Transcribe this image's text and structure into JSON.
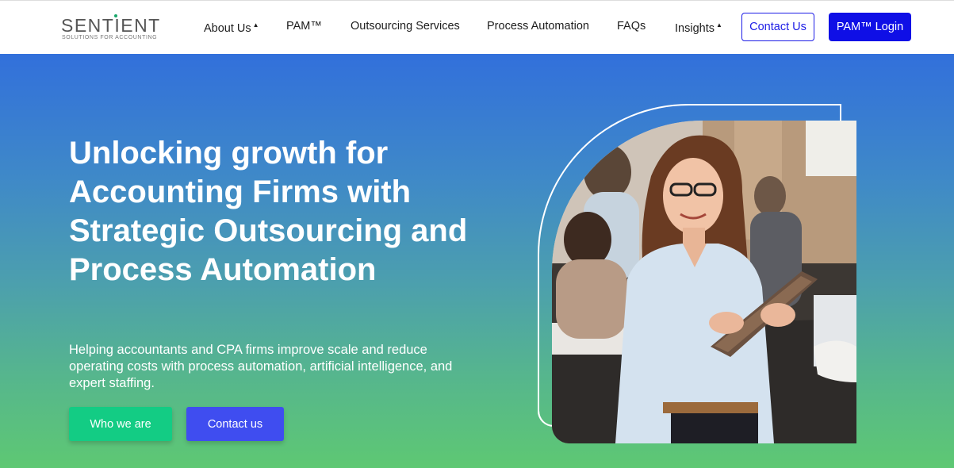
{
  "brand": {
    "name": "SENTIENT",
    "tagline": "SOLUTIONS FOR ACCOUNTING",
    "accent_color": "#19a76b"
  },
  "nav": {
    "items": [
      {
        "label": "About Us",
        "has_dropdown": true
      },
      {
        "label": "PAM™",
        "has_dropdown": false
      },
      {
        "label": "Outsourcing Services",
        "has_dropdown": false
      },
      {
        "label": "Process Automation",
        "has_dropdown": false
      },
      {
        "label": "FAQs",
        "has_dropdown": false
      },
      {
        "label": "Insights",
        "has_dropdown": true
      }
    ],
    "caret": "▲",
    "contact_label": "Contact Us",
    "login_label": "PAM™ Login"
  },
  "hero": {
    "title": "Unlocking growth for Accounting Firms with Strategic Outsourcing and Process Automation",
    "subtitle": "Helping accountants and CPA firms improve scale and reduce operating costs with process automation, artificial intelligence, and expert staffing.",
    "primary_button": "Who we are",
    "secondary_button": "Contact us",
    "image": "woman-holding-tablet-photo"
  },
  "colors": {
    "gradient_top": "#3270db",
    "gradient_bottom": "#5ec873",
    "primary_button": "#13cc84",
    "secondary_button": "#3f4df0",
    "login_button": "#0f0fe6"
  }
}
